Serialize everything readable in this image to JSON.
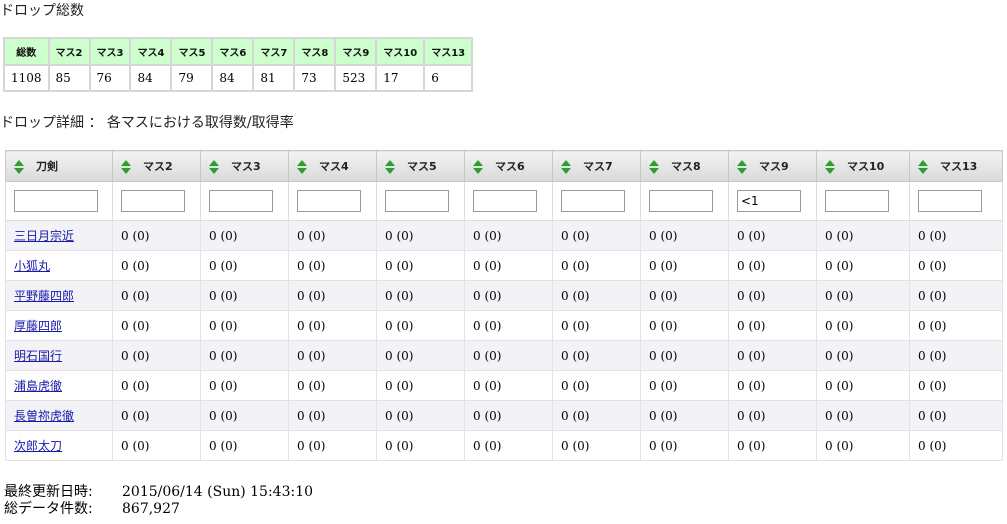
{
  "titles": {
    "drop_total": "ドロップ総数",
    "drop_detail": "ドロップ詳細 ： 各マスにおける取得数/取得率"
  },
  "total_table": {
    "headers": [
      "総数",
      "マス2",
      "マス3",
      "マス4",
      "マス5",
      "マス6",
      "マス7",
      "マス8",
      "マス9",
      "マス10",
      "マス13"
    ],
    "values": [
      "1108",
      "85",
      "76",
      "84",
      "79",
      "84",
      "81",
      "73",
      "523",
      "17",
      "6"
    ]
  },
  "detail_table": {
    "headers": [
      "刀剣",
      "マス2",
      "マス3",
      "マス4",
      "マス5",
      "マス6",
      "マス7",
      "マス8",
      "マス9",
      "マス10",
      "マス13"
    ],
    "filters": [
      "",
      "",
      "",
      "",
      "",
      "",
      "",
      "",
      "<1",
      "",
      ""
    ],
    "rows": [
      {
        "name": "三日月宗近",
        "cells": [
          "0 (0)",
          "0 (0)",
          "0 (0)",
          "0 (0)",
          "0 (0)",
          "0 (0)",
          "0 (0)",
          "0 (0)",
          "0 (0)",
          "0 (0)"
        ]
      },
      {
        "name": "小狐丸",
        "cells": [
          "0 (0)",
          "0 (0)",
          "0 (0)",
          "0 (0)",
          "0 (0)",
          "0 (0)",
          "0 (0)",
          "0 (0)",
          "0 (0)",
          "0 (0)"
        ]
      },
      {
        "name": "平野藤四郎",
        "cells": [
          "0 (0)",
          "0 (0)",
          "0 (0)",
          "0 (0)",
          "0 (0)",
          "0 (0)",
          "0 (0)",
          "0 (0)",
          "0 (0)",
          "0 (0)"
        ]
      },
      {
        "name": "厚藤四郎",
        "cells": [
          "0 (0)",
          "0 (0)",
          "0 (0)",
          "0 (0)",
          "0 (0)",
          "0 (0)",
          "0 (0)",
          "0 (0)",
          "0 (0)",
          "0 (0)"
        ]
      },
      {
        "name": "明石国行",
        "cells": [
          "0 (0)",
          "0 (0)",
          "0 (0)",
          "0 (0)",
          "0 (0)",
          "0 (0)",
          "0 (0)",
          "0 (0)",
          "0 (0)",
          "0 (0)"
        ]
      },
      {
        "name": "浦島虎徹",
        "cells": [
          "0 (0)",
          "0 (0)",
          "0 (0)",
          "0 (0)",
          "0 (0)",
          "0 (0)",
          "0 (0)",
          "0 (0)",
          "0 (0)",
          "0 (0)"
        ]
      },
      {
        "name": "長曽祢虎徹",
        "cells": [
          "0 (0)",
          "0 (0)",
          "0 (0)",
          "0 (0)",
          "0 (0)",
          "0 (0)",
          "0 (0)",
          "0 (0)",
          "0 (0)",
          "0 (0)"
        ]
      },
      {
        "name": "次郎太刀",
        "cells": [
          "0 (0)",
          "0 (0)",
          "0 (0)",
          "0 (0)",
          "0 (0)",
          "0 (0)",
          "0 (0)",
          "0 (0)",
          "0 (0)",
          "0 (0)"
        ]
      }
    ]
  },
  "footer": {
    "updated_label": "最終更新日時:",
    "updated_value": "2015/06/14 (Sun) 15:43:10",
    "count_label": "総データ件数:",
    "count_value": "867,927"
  },
  "icons": {
    "sort": "sort-up-down-icon"
  },
  "colors": {
    "total_header_bg": "#ccffcc",
    "link": "#1a1aa8",
    "sort_icon": "#2e9e2e"
  }
}
